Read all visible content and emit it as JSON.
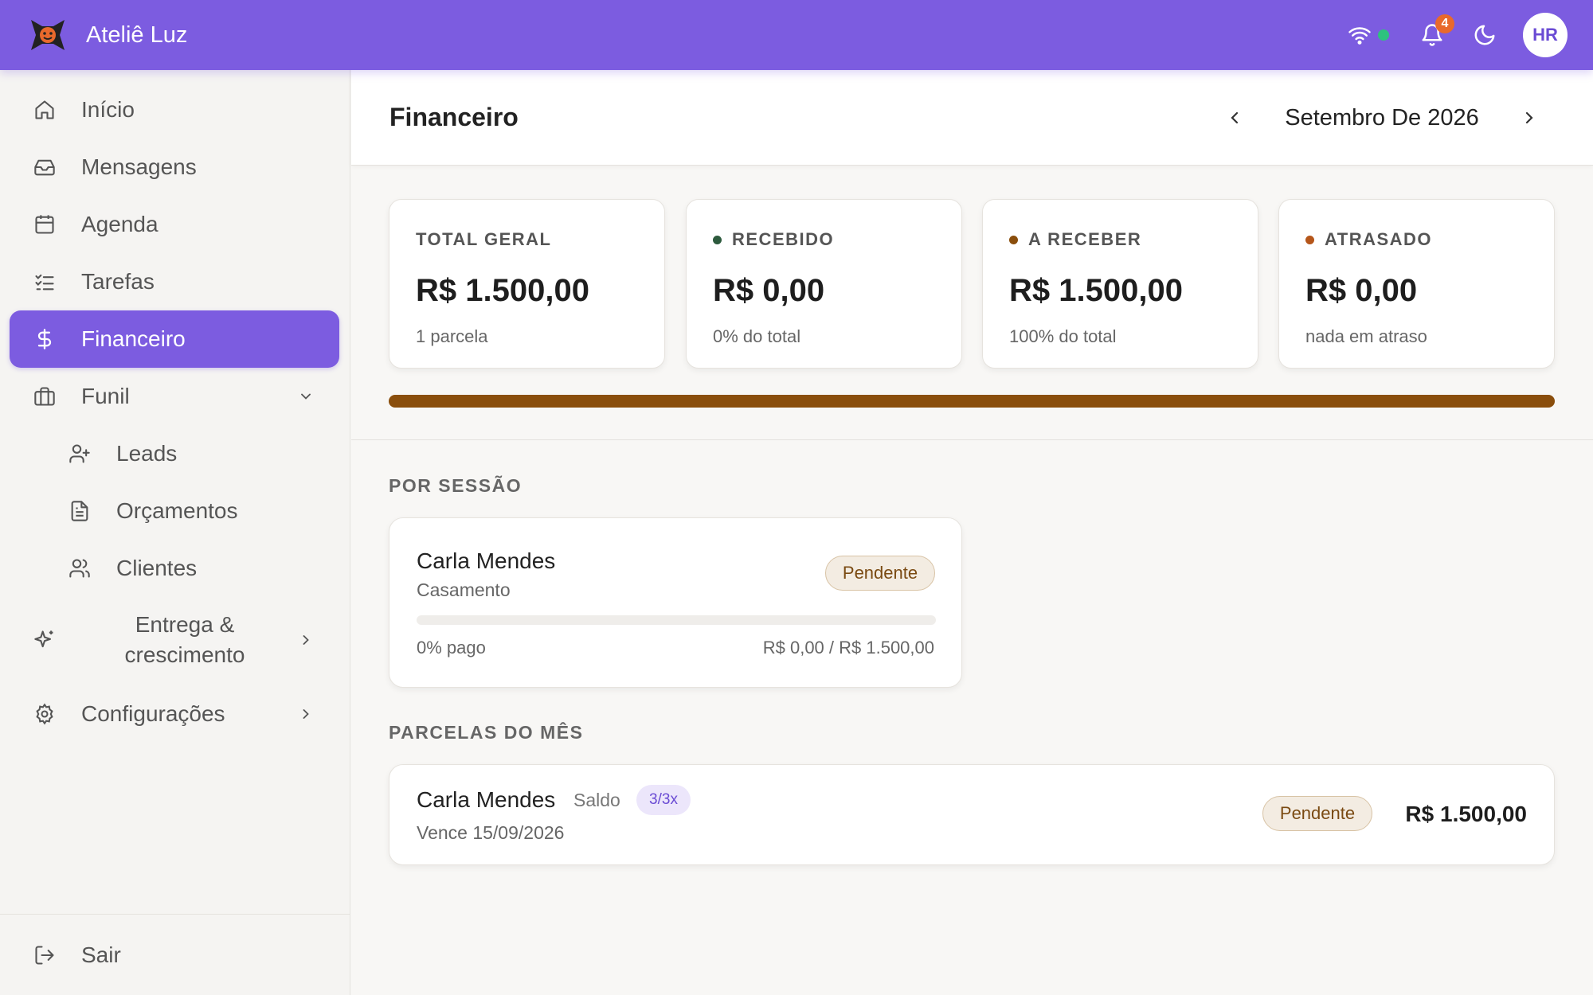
{
  "app": {
    "name": "Ateliê Luz",
    "notifications": "4",
    "avatar": "HR"
  },
  "sidebar": {
    "items": [
      {
        "label": "Início",
        "icon": "home-icon"
      },
      {
        "label": "Mensagens",
        "icon": "inbox-icon"
      },
      {
        "label": "Agenda",
        "icon": "calendar-icon"
      },
      {
        "label": "Tarefas",
        "icon": "checklist-icon"
      },
      {
        "label": "Financeiro",
        "icon": "dollar-icon",
        "active": true
      },
      {
        "label": "Funil",
        "icon": "briefcase-icon",
        "expanded": true
      },
      {
        "label": "Leads",
        "icon": "user-plus-icon"
      },
      {
        "label": "Orçamentos",
        "icon": "document-icon"
      },
      {
        "label": "Clientes",
        "icon": "users-icon"
      },
      {
        "label": "Entrega & crescimento",
        "icon": "sparkles-icon"
      },
      {
        "label": "Configurações",
        "icon": "gear-icon"
      }
    ],
    "logout": "Sair"
  },
  "header": {
    "title": "Financeiro",
    "month": "Setembro De 2026"
  },
  "stats": [
    {
      "label": "TOTAL GERAL",
      "value": "R$ 1.500,00",
      "sub": "1 parcela",
      "dot": ""
    },
    {
      "label": "RECEBIDO",
      "value": "R$ 0,00",
      "sub": "0% do total",
      "dot": "#2d5a3d"
    },
    {
      "label": "A RECEBER",
      "value": "R$ 1.500,00",
      "sub": "100% do total",
      "dot": "#8a4e0c"
    },
    {
      "label": "ATRASADO",
      "value": "R$ 0,00",
      "sub": "nada em atraso",
      "dot": "#b5561a"
    }
  ],
  "overall_progress": {
    "pending_fraction": 1.0,
    "color": "#8a4e0c"
  },
  "sessions": {
    "title": "POR SESSÃO",
    "items": [
      {
        "client": "Carla Mendes",
        "type": "Casamento",
        "status": "Pendente",
        "paid_fraction": 0,
        "paid_label": "0% pago",
        "amounts": "R$ 0,00 / R$ 1.500,00"
      }
    ]
  },
  "installments": {
    "title": "PARCELAS DO MÊS",
    "items": [
      {
        "client": "Carla Mendes",
        "kind": "Saldo",
        "count": "3/3x",
        "due": "Vence 15/09/2026",
        "status": "Pendente",
        "amount": "R$ 1.500,00"
      }
    ]
  },
  "colors": {
    "accent": "#7c5ce0",
    "brown": "#8a4e0c",
    "online": "#2ec27e",
    "badge": "#e8692c"
  }
}
